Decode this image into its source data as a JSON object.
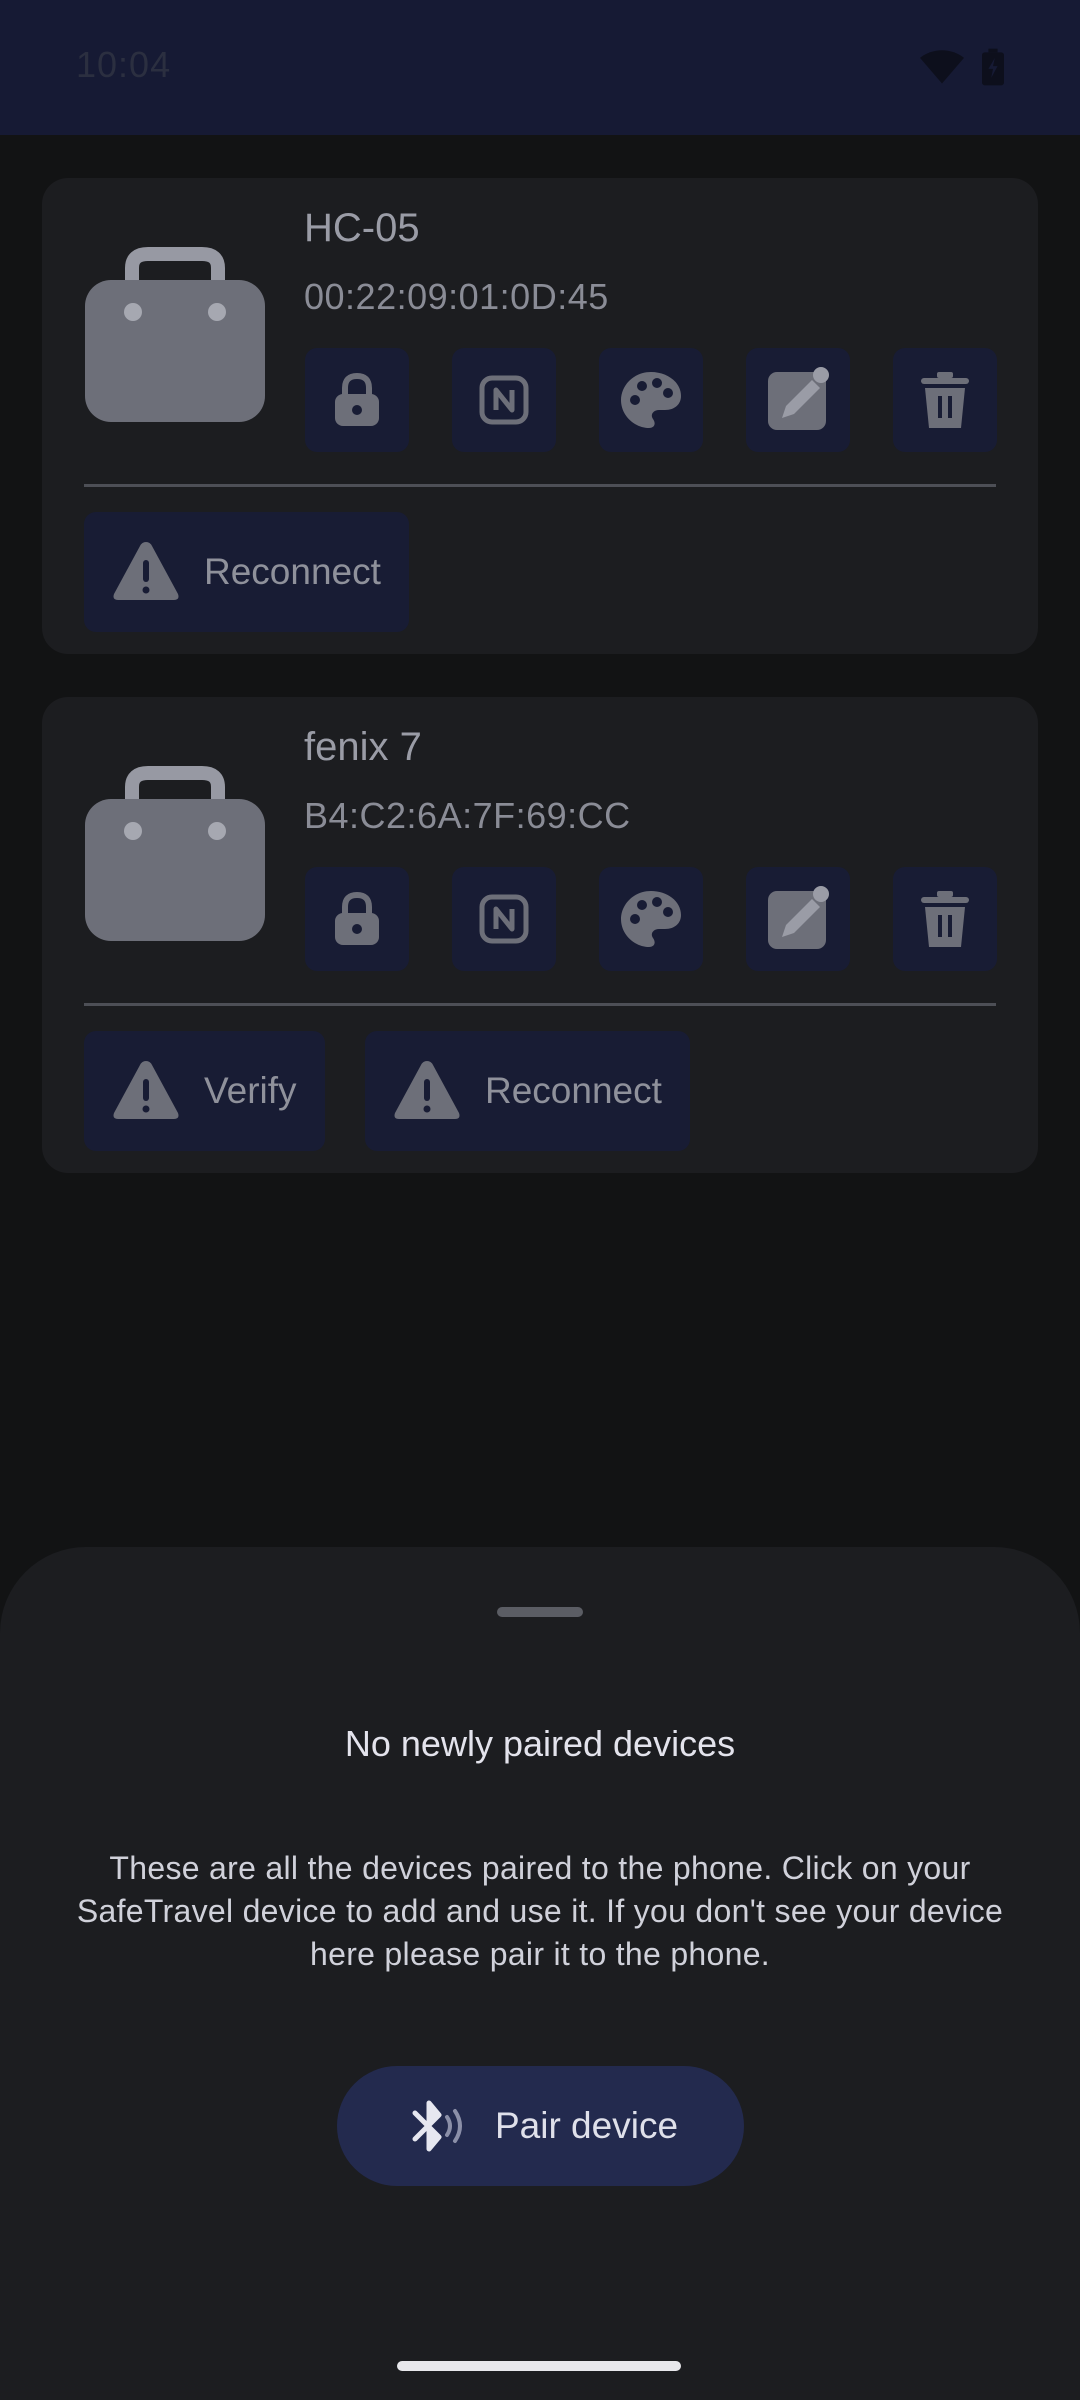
{
  "status_bar": {
    "time": "10:04",
    "wifi_icon": "wifi-icon",
    "battery_icon": "battery-icon",
    "background": "#161a34"
  },
  "devices": [
    {
      "name": "HC-05",
      "mac": "00:22:09:01:0D:45",
      "icon": "luggage-icon",
      "actions": [
        "lock-icon",
        "nfc-icon",
        "palette-icon",
        "edit-icon",
        "delete-icon"
      ],
      "chips": [
        {
          "label": "Reconnect",
          "icon": "warning-icon"
        }
      ]
    },
    {
      "name": "fenix 7",
      "mac": "B4:C2:6A:7F:69:CC",
      "icon": "luggage-icon",
      "actions": [
        "lock-icon",
        "nfc-icon",
        "palette-icon",
        "edit-icon",
        "delete-icon"
      ],
      "chips": [
        {
          "label": "Verify",
          "icon": "warning-icon"
        },
        {
          "label": "Reconnect",
          "icon": "warning-icon"
        }
      ]
    }
  ],
  "sheet": {
    "title": "No newly paired devices",
    "body": "These are all the devices paired to the phone. Click on your SafeTravel device to add and use it. If you don't see your device here please pair it to the phone.",
    "pair_button_label": "Pair device",
    "pair_button_icon": "bluetooth-searching-icon"
  },
  "colors": {
    "background": "#121314",
    "card": "#1c1d20",
    "chip": "#181c34",
    "primary_button": "#232a4e"
  }
}
